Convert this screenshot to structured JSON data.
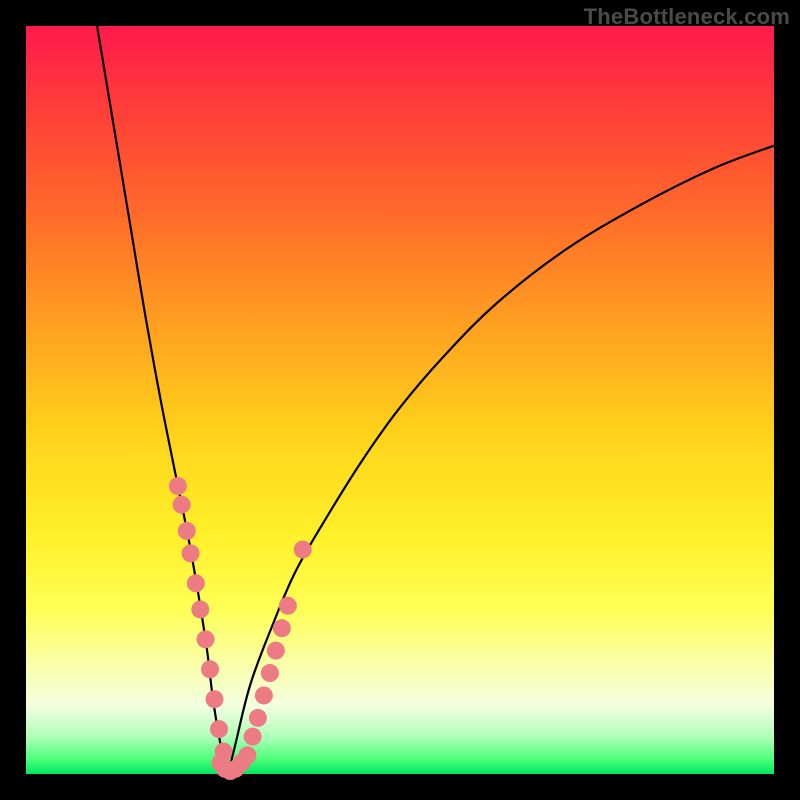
{
  "watermark": "TheBottleneck.com",
  "chart_data": {
    "type": "line",
    "title": "",
    "xlabel": "",
    "ylabel": "",
    "xlim": [
      0,
      100
    ],
    "ylim": [
      0,
      100
    ],
    "minimum_x": 27,
    "left_curve": {
      "x": [
        9.5,
        12,
        14,
        16,
        18,
        20,
        22,
        24,
        25,
        26,
        27
      ],
      "y": [
        100,
        85,
        73,
        61,
        50,
        40,
        30,
        18,
        10,
        4,
        0
      ]
    },
    "right_curve": {
      "x": [
        27,
        28,
        30,
        33,
        36,
        40,
        45,
        50,
        56,
        63,
        72,
        82,
        92,
        100
      ],
      "y": [
        0,
        4,
        12,
        20,
        27,
        34,
        42,
        49,
        56,
        63,
        70,
        76,
        81,
        84
      ]
    },
    "markers_left": {
      "x": [
        20.3,
        20.8,
        21.5,
        22.0,
        22.7,
        23.3,
        24.0,
        24.6,
        25.2,
        25.8,
        26.4
      ],
      "y": [
        38.5,
        36.0,
        32.5,
        29.5,
        25.5,
        22.0,
        18.0,
        14.0,
        10.0,
        6.0,
        3.0
      ]
    },
    "markers_bottom": {
      "x": [
        26.0,
        26.6,
        27.3,
        28.0,
        28.8,
        29.6
      ],
      "y": [
        1.5,
        0.7,
        0.4,
        0.7,
        1.5,
        2.5
      ]
    },
    "markers_right": {
      "x": [
        30.3,
        31.0,
        31.8,
        32.6,
        33.4,
        34.2,
        35.0,
        37.0
      ],
      "y": [
        5.0,
        7.5,
        10.5,
        13.5,
        16.5,
        19.5,
        22.5,
        30.0
      ]
    },
    "marker_radius": 9
  }
}
